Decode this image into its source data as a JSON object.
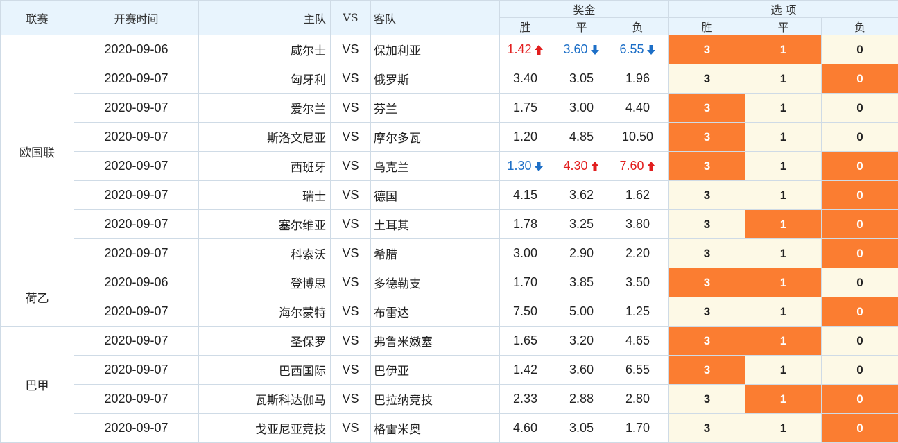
{
  "header": {
    "league": "联赛",
    "time": "开赛时间",
    "home": "主队",
    "vs": "VS",
    "away": "客队",
    "prize": "奖金",
    "options": "选 项",
    "win": "胜",
    "draw": "平",
    "lose": "负"
  },
  "colors": {
    "selected": "#fb7d31",
    "unselected": "#fdf9e6",
    "up": "#e21e1e",
    "down": "#1d6fc7",
    "header_bg": "#e8f4fd"
  },
  "leagues": [
    {
      "name": "欧国联",
      "rows": 8
    },
    {
      "name": "荷乙",
      "rows": 2
    },
    {
      "name": "巴甲",
      "rows": 4
    }
  ],
  "matches": [
    {
      "date": "2020-09-06",
      "home": "威尔士",
      "vs": "VS",
      "away": "保加利亚",
      "prizes": [
        {
          "v": "1.42",
          "t": "up"
        },
        {
          "v": "3.60",
          "t": "down"
        },
        {
          "v": "6.55",
          "t": "down"
        }
      ],
      "sel": [
        true,
        true,
        false
      ],
      "opts": [
        "3",
        "1",
        "0"
      ]
    },
    {
      "date": "2020-09-07",
      "home": "匈牙利",
      "vs": "VS",
      "away": "俄罗斯",
      "prizes": [
        {
          "v": "3.40",
          "t": ""
        },
        {
          "v": "3.05",
          "t": ""
        },
        {
          "v": "1.96",
          "t": ""
        }
      ],
      "sel": [
        false,
        false,
        true
      ],
      "opts": [
        "3",
        "1",
        "0"
      ]
    },
    {
      "date": "2020-09-07",
      "home": "爱尔兰",
      "vs": "VS",
      "away": "芬兰",
      "prizes": [
        {
          "v": "1.75",
          "t": ""
        },
        {
          "v": "3.00",
          "t": ""
        },
        {
          "v": "4.40",
          "t": ""
        }
      ],
      "sel": [
        true,
        false,
        false
      ],
      "opts": [
        "3",
        "1",
        "0"
      ]
    },
    {
      "date": "2020-09-07",
      "home": "斯洛文尼亚",
      "vs": "VS",
      "away": "摩尔多瓦",
      "prizes": [
        {
          "v": "1.20",
          "t": ""
        },
        {
          "v": "4.85",
          "t": ""
        },
        {
          "v": "10.50",
          "t": ""
        }
      ],
      "sel": [
        true,
        false,
        false
      ],
      "opts": [
        "3",
        "1",
        "0"
      ]
    },
    {
      "date": "2020-09-07",
      "home": "西班牙",
      "vs": "VS",
      "away": "乌克兰",
      "prizes": [
        {
          "v": "1.30",
          "t": "down"
        },
        {
          "v": "4.30",
          "t": "up"
        },
        {
          "v": "7.60",
          "t": "up"
        }
      ],
      "sel": [
        true,
        false,
        true
      ],
      "opts": [
        "3",
        "1",
        "0"
      ]
    },
    {
      "date": "2020-09-07",
      "home": "瑞士",
      "vs": "VS",
      "away": "德国",
      "prizes": [
        {
          "v": "4.15",
          "t": ""
        },
        {
          "v": "3.62",
          "t": ""
        },
        {
          "v": "1.62",
          "t": ""
        }
      ],
      "sel": [
        false,
        false,
        true
      ],
      "opts": [
        "3",
        "1",
        "0"
      ]
    },
    {
      "date": "2020-09-07",
      "home": "塞尔维亚",
      "vs": "VS",
      "away": "土耳其",
      "prizes": [
        {
          "v": "1.78",
          "t": ""
        },
        {
          "v": "3.25",
          "t": ""
        },
        {
          "v": "3.80",
          "t": ""
        }
      ],
      "sel": [
        false,
        true,
        true
      ],
      "opts": [
        "3",
        "1",
        "0"
      ]
    },
    {
      "date": "2020-09-07",
      "home": "科索沃",
      "vs": "VS",
      "away": "希腊",
      "prizes": [
        {
          "v": "3.00",
          "t": ""
        },
        {
          "v": "2.90",
          "t": ""
        },
        {
          "v": "2.20",
          "t": ""
        }
      ],
      "sel": [
        false,
        false,
        true
      ],
      "opts": [
        "3",
        "1",
        "0"
      ]
    },
    {
      "date": "2020-09-06",
      "home": "登博思",
      "vs": "VS",
      "away": "多德勒支",
      "prizes": [
        {
          "v": "1.70",
          "t": ""
        },
        {
          "v": "3.85",
          "t": ""
        },
        {
          "v": "3.50",
          "t": ""
        }
      ],
      "sel": [
        true,
        true,
        false
      ],
      "opts": [
        "3",
        "1",
        "0"
      ]
    },
    {
      "date": "2020-09-07",
      "home": "海尔蒙特",
      "vs": "VS",
      "away": "布雷达",
      "prizes": [
        {
          "v": "7.50",
          "t": ""
        },
        {
          "v": "5.00",
          "t": ""
        },
        {
          "v": "1.25",
          "t": ""
        }
      ],
      "sel": [
        false,
        false,
        true
      ],
      "opts": [
        "3",
        "1",
        "0"
      ]
    },
    {
      "date": "2020-09-07",
      "home": "圣保罗",
      "vs": "VS",
      "away": "弗鲁米嫩塞",
      "prizes": [
        {
          "v": "1.65",
          "t": ""
        },
        {
          "v": "3.20",
          "t": ""
        },
        {
          "v": "4.65",
          "t": ""
        }
      ],
      "sel": [
        true,
        true,
        false
      ],
      "opts": [
        "3",
        "1",
        "0"
      ]
    },
    {
      "date": "2020-09-07",
      "home": "巴西国际",
      "vs": "VS",
      "away": "巴伊亚",
      "prizes": [
        {
          "v": "1.42",
          "t": ""
        },
        {
          "v": "3.60",
          "t": ""
        },
        {
          "v": "6.55",
          "t": ""
        }
      ],
      "sel": [
        true,
        false,
        false
      ],
      "opts": [
        "3",
        "1",
        "0"
      ]
    },
    {
      "date": "2020-09-07",
      "home": "瓦斯科达伽马",
      "vs": "VS",
      "away": "巴拉纳竞技",
      "prizes": [
        {
          "v": "2.33",
          "t": ""
        },
        {
          "v": "2.88",
          "t": ""
        },
        {
          "v": "2.80",
          "t": ""
        }
      ],
      "sel": [
        false,
        true,
        true
      ],
      "opts": [
        "3",
        "1",
        "0"
      ]
    },
    {
      "date": "2020-09-07",
      "home": "戈亚尼亚竞技",
      "vs": "VS",
      "away": "格雷米奥",
      "prizes": [
        {
          "v": "4.60",
          "t": ""
        },
        {
          "v": "3.05",
          "t": ""
        },
        {
          "v": "1.70",
          "t": ""
        }
      ],
      "sel": [
        false,
        false,
        true
      ],
      "opts": [
        "3",
        "1",
        "0"
      ]
    }
  ]
}
